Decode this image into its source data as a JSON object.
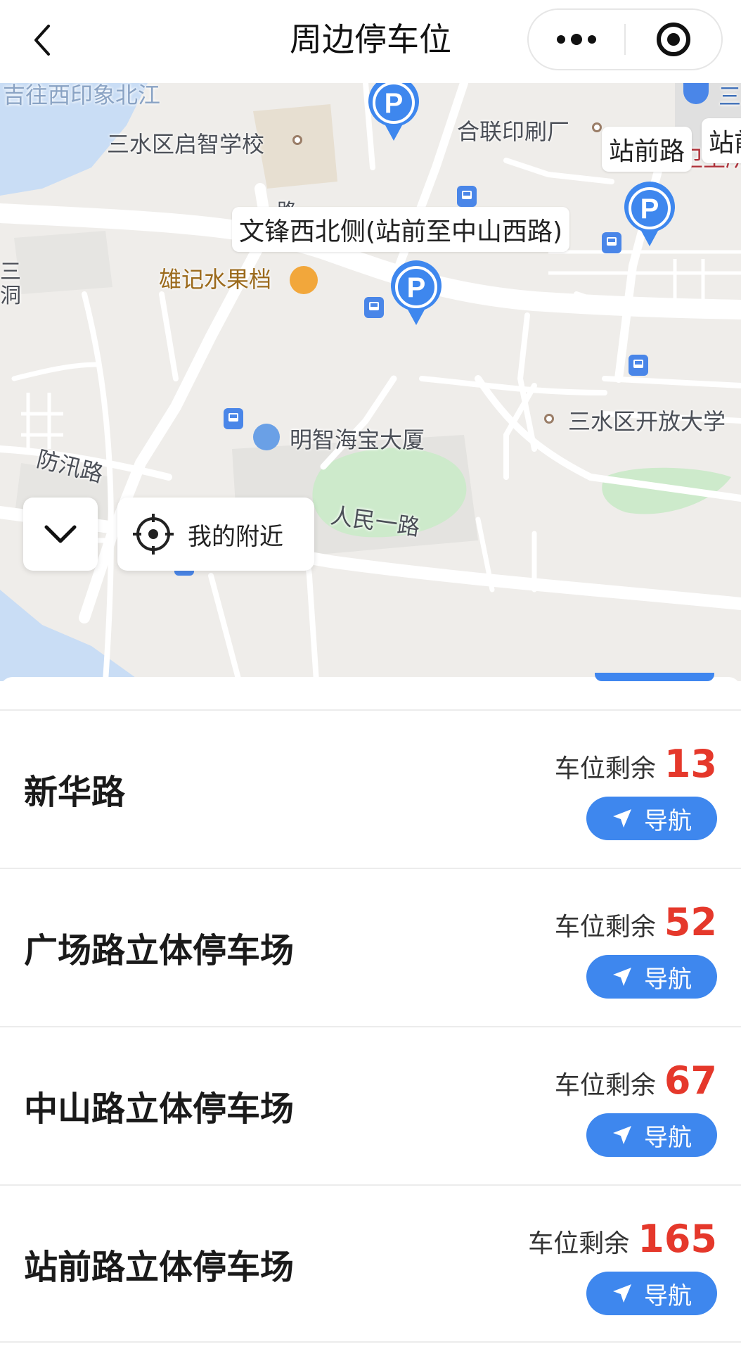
{
  "header": {
    "title": "周边停车位",
    "back_icon": "chevron-left-icon",
    "more_icon": "more-dots-icon",
    "close_icon": "target-close-icon"
  },
  "map": {
    "labels": {
      "top_faded": "吉往西印象北江",
      "school": "三水区启智学校",
      "printing": "合联印刷厂",
      "fruit": "雄记水果档",
      "building": "明智海宝大厦",
      "university": "三水区开放大学",
      "flood_road": "防汛路",
      "renmin_road": "人民一路",
      "road_fragment": "路",
      "hospital": "卫生所",
      "metro": "三",
      "left_edge": "三\n洞"
    },
    "callouts": {
      "wenfeng": "文锋西北侧(站前至中山西路)",
      "zhanqian": "站前路",
      "zhanqian_cut": "站前"
    },
    "controls": {
      "fold_icon": "chevron-down-icon",
      "nearby_label": "我的附近",
      "nearby_icon": "locate-target-icon"
    },
    "colors": {
      "parking_marker": "#3e87ee",
      "water": "#c9ddf5",
      "green": "#cdeacb"
    }
  },
  "list": {
    "remain_label": "车位剩余",
    "nav_label": "导航",
    "nav_icon": "navigation-arrow-icon",
    "items": [
      {
        "name": "新华路",
        "remaining": "13"
      },
      {
        "name": "广场路立体停车场",
        "remaining": "52"
      },
      {
        "name": "中山路立体停车场",
        "remaining": "67"
      },
      {
        "name": "站前路立体停车场",
        "remaining": "165"
      }
    ],
    "colors": {
      "remaining": "#e5382b",
      "button": "#3e87ee"
    }
  }
}
